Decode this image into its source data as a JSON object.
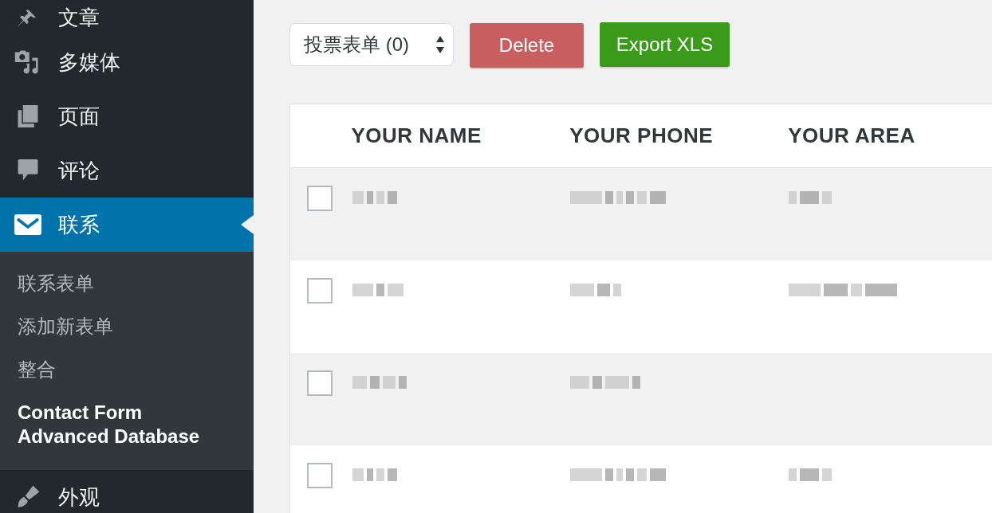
{
  "sidebar": {
    "items": [
      {
        "label": "文章",
        "selected": false
      },
      {
        "label": "多媒体",
        "selected": false
      },
      {
        "label": "页面",
        "selected": false
      },
      {
        "label": "评论",
        "selected": false
      },
      {
        "label": "联系",
        "selected": true,
        "submenu": [
          {
            "label": "联系表单",
            "selected": false
          },
          {
            "label": "添加新表单",
            "selected": false
          },
          {
            "label": "整合",
            "selected": false
          },
          {
            "label": "Contact Form Advanced Database",
            "selected": true
          }
        ]
      },
      {
        "label": "外观",
        "selected": false
      }
    ]
  },
  "toolbar": {
    "form_select": "投票表单 (0)",
    "buttons": [
      {
        "label": "Delete",
        "kind": "delete"
      },
      {
        "label": "Export XLS",
        "kind": "export"
      }
    ]
  },
  "table": {
    "columns": [
      "YOUR NAME",
      "YOUR PHONE",
      "YOUR AREA"
    ],
    "rows": [
      {
        "checked": false,
        "cells": [
          {
            "kind": "blurred"
          },
          {
            "kind": "blurred"
          },
          {
            "kind": "blurred"
          }
        ]
      },
      {
        "checked": false,
        "cells": [
          {
            "kind": "blurred"
          },
          {
            "kind": "blurred"
          },
          {
            "kind": "blurred"
          }
        ]
      },
      {
        "checked": false,
        "cells": [
          {
            "kind": "blurred"
          },
          {
            "kind": "blurred"
          },
          {
            "kind": "empty"
          }
        ]
      },
      {
        "checked": false,
        "cells": [
          {
            "kind": "blurred"
          },
          {
            "kind": "blurred"
          },
          {
            "kind": "blurred"
          }
        ]
      }
    ]
  }
}
